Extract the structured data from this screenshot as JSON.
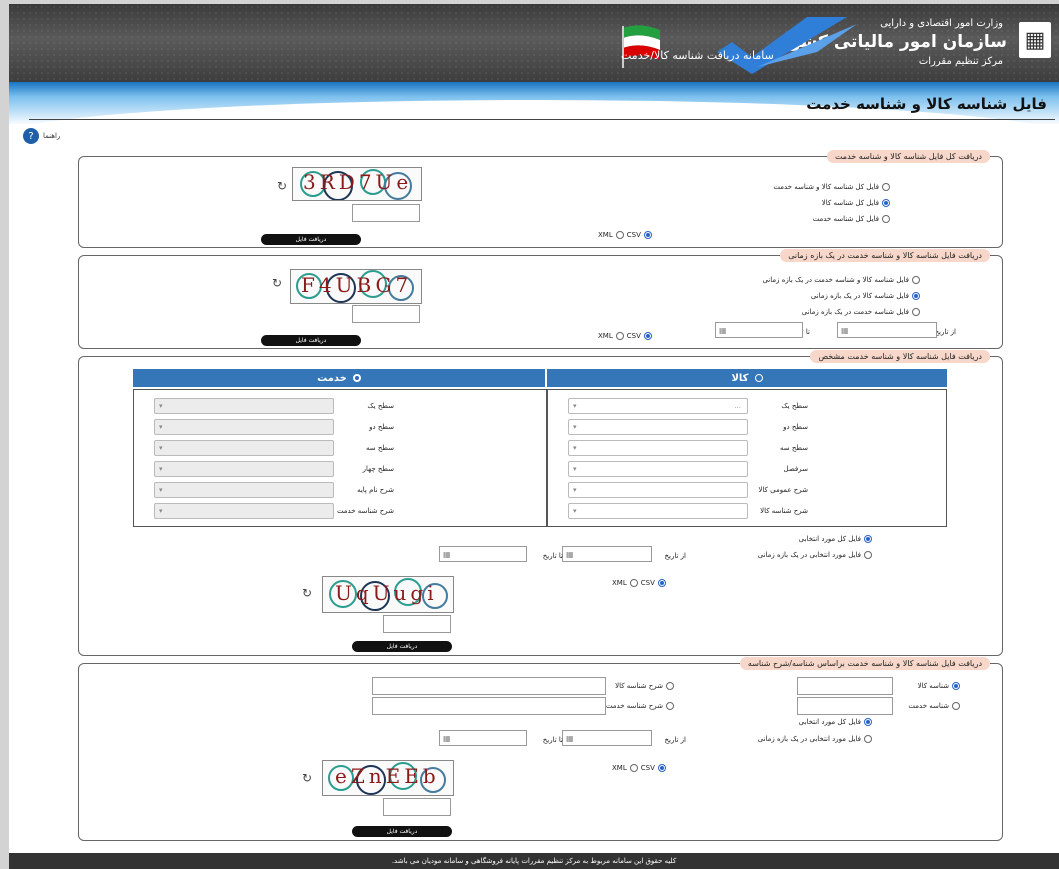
{
  "header": {
    "ministry": "وزارت امور اقتصادی و دارایی",
    "org_name": "سازمان امور مالیاتی کشور",
    "org_sub": "مرکز تنظیم مقررات",
    "system_title": "سامانه دریافت شناسه کالا/خدمت"
  },
  "page_title": "فایل شناسه کالا و شناسه خدمت",
  "help_label": "راهنما",
  "section1": {
    "legend": "دریافت کل فایل شناسه کالا و شناسه خدمت",
    "options": [
      "فایل کل شناسه کالا و شناسه خدمت",
      "فایل کل شناسه کالا",
      "فایل کل شناسه خدمت"
    ],
    "captcha": "3RD7Ue",
    "download": "دریافت فایل"
  },
  "section2": {
    "legend": "دریافت فایل شناسه کالا و شناسه خدمت در یک بازه زمانی",
    "options": [
      "فایل شناسه کالا و شناسه خدمت در یک بازه زمانی",
      "فایل شناسه کالا در یک بازه زمانی",
      "فایل شناسه خدمت در یک بازه زمانی"
    ],
    "from_label": "از تاریخ",
    "to_label": "تا تاریخ",
    "captcha": "F4UBG7",
    "download": "دریافت فایل"
  },
  "section3": {
    "legend": "دریافت فایل شناسه کالا و شناسه خدمت مشخص",
    "goods_head": "کالا",
    "service_head": "خدمت",
    "goods_fields": [
      "سطح یک",
      "سطح دو",
      "سطح سه",
      "سرفصل",
      "شرح عمومی کالا",
      "شرح شناسه کالا"
    ],
    "goods_first_value": "...",
    "service_fields": [
      "سطح یک",
      "سطح دو",
      "سطح سه",
      "سطح چهار",
      "شرح نام پایه",
      "شرح شناسه خدمت"
    ],
    "options": [
      "فایل کل مورد انتخابی",
      "فایل مورد انتخابی در یک بازه زمانی"
    ],
    "from_label": "از تاریخ",
    "to_label": "تا تاریخ",
    "captcha": "UqUugi",
    "download": "دریافت فایل"
  },
  "section4": {
    "legend": "دریافت فایل شناسه کالا و شناسه خدمت براساس شناسه/شرح شناسه",
    "goods_id": "شناسه کالا",
    "service_id": "شناسه خدمت",
    "goods_desc": "شرح شناسه کالا",
    "service_desc": "شرح شناسه خدمت",
    "options": [
      "فایل کل مورد انتخابی",
      "فایل مورد انتخابی در یک بازه زمانی"
    ],
    "from_label": "از تاریخ",
    "to_label": "تا تاریخ",
    "captcha": "eZnEEb",
    "download": "دریافت فایل"
  },
  "format": {
    "xml": "XML",
    "csv": "CSV"
  },
  "footer": "کلیه حقوق این سامانه مربوط به مرکز تنظیم مقررات پایانه فروشگاهی و سامانه مودیان می باشد.",
  "colors": {
    "accent": "#3476b8",
    "legend_bg": "#f7d7c9",
    "header_bg": "#4a4a4a"
  }
}
